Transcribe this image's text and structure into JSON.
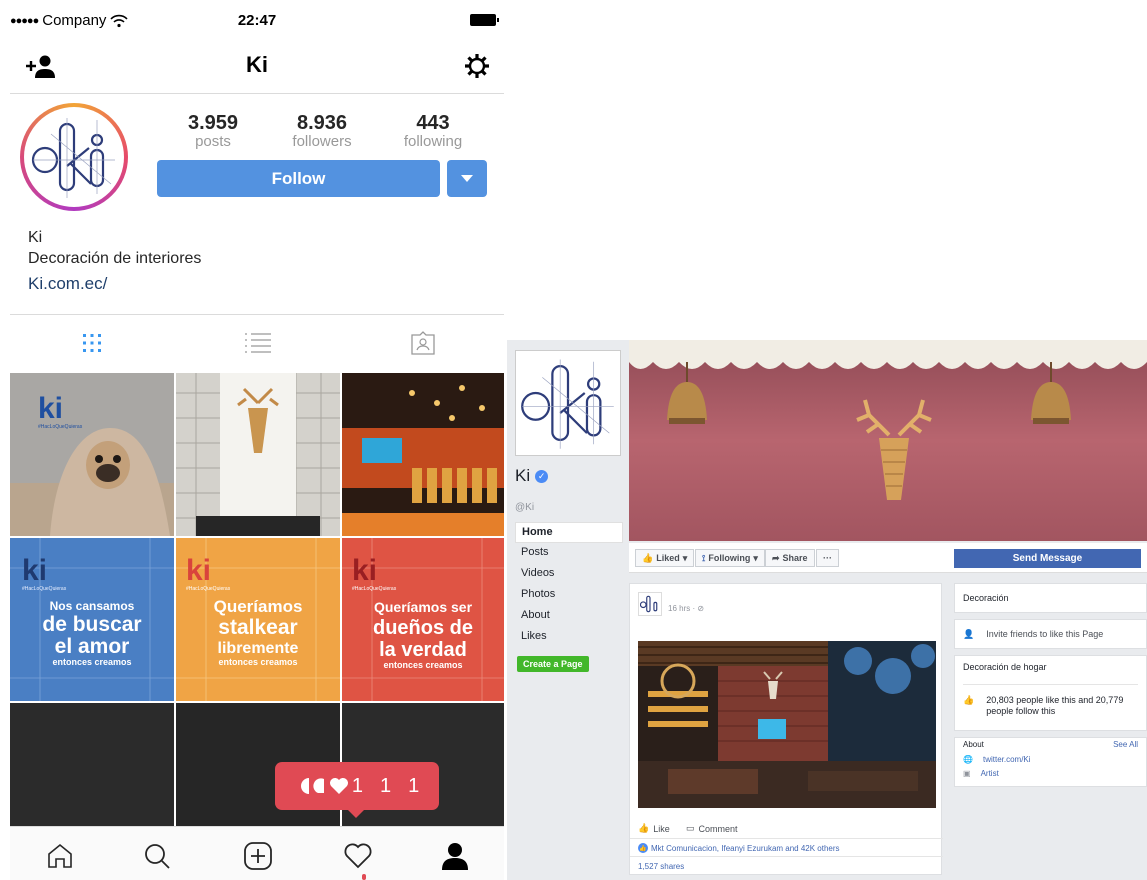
{
  "instagram": {
    "status": {
      "carrier": "Company",
      "time": "22:47"
    },
    "title": "Ki",
    "stats": [
      {
        "value": "3.959",
        "label": "posts"
      },
      {
        "value": "8.936",
        "label": "followers"
      },
      {
        "value": "443",
        "label": "following"
      }
    ],
    "follow_label": "Follow",
    "bio": {
      "name": "Ki",
      "description": "Decoración de interiores",
      "link": "Ki.com.ec/"
    },
    "grid": [
      {
        "badge": "ki",
        "tag": "#HacLoQueQuieras"
      },
      {},
      {},
      {
        "badge": "ki",
        "tag": "#HacLoQueQuieras",
        "line1": "Nos cansamos",
        "line2": "de buscar",
        "line3": "el amor",
        "line4": "entonces creamos"
      },
      {
        "badge": "ki",
        "tag": "#HacLoQueQuieras",
        "line1": "Queríamos",
        "line2": "stalkear",
        "line3": "libremente",
        "line4": "entonces creamos"
      },
      {
        "badge": "ki",
        "tag": "#HacLoQueQuieras",
        "line1": "Queríamos ser",
        "line2": "dueños de",
        "line3": "la verdad",
        "line4": "entonces creamos"
      }
    ],
    "notification": {
      "a": "1",
      "b": "1",
      "c": "1"
    },
    "colors": {
      "accent": "#5392e0",
      "notification": "#e04a54"
    }
  },
  "facebook": {
    "page_name": "Ki",
    "handle": "@Ki",
    "nav": [
      "Home",
      "Posts",
      "Videos",
      "Photos",
      "About",
      "Likes"
    ],
    "create_page": "Create a Page",
    "actions": {
      "liked": "Liked",
      "following": "Following",
      "share": "Share",
      "more": "···"
    },
    "send_message": "Send Message",
    "post": {
      "time": "16 hrs · ",
      "like": "Like",
      "comment": "Comment",
      "reactions": "Mkt Comunicacion, Ifeanyi Ezurukam and 42K others",
      "shares": "1,527 shares"
    },
    "sidebar": {
      "category": "Decoración",
      "invite": "Invite friends to like this Page",
      "category2": "Decoración de hogar",
      "likes": "20,803 people like this and 20,779 people follow this",
      "about": "About",
      "see_all": "See All",
      "twitter": "twitter.com/Ki",
      "artist": "Artist"
    },
    "colors": {
      "primary": "#4267b2",
      "create": "#42b72a"
    }
  }
}
